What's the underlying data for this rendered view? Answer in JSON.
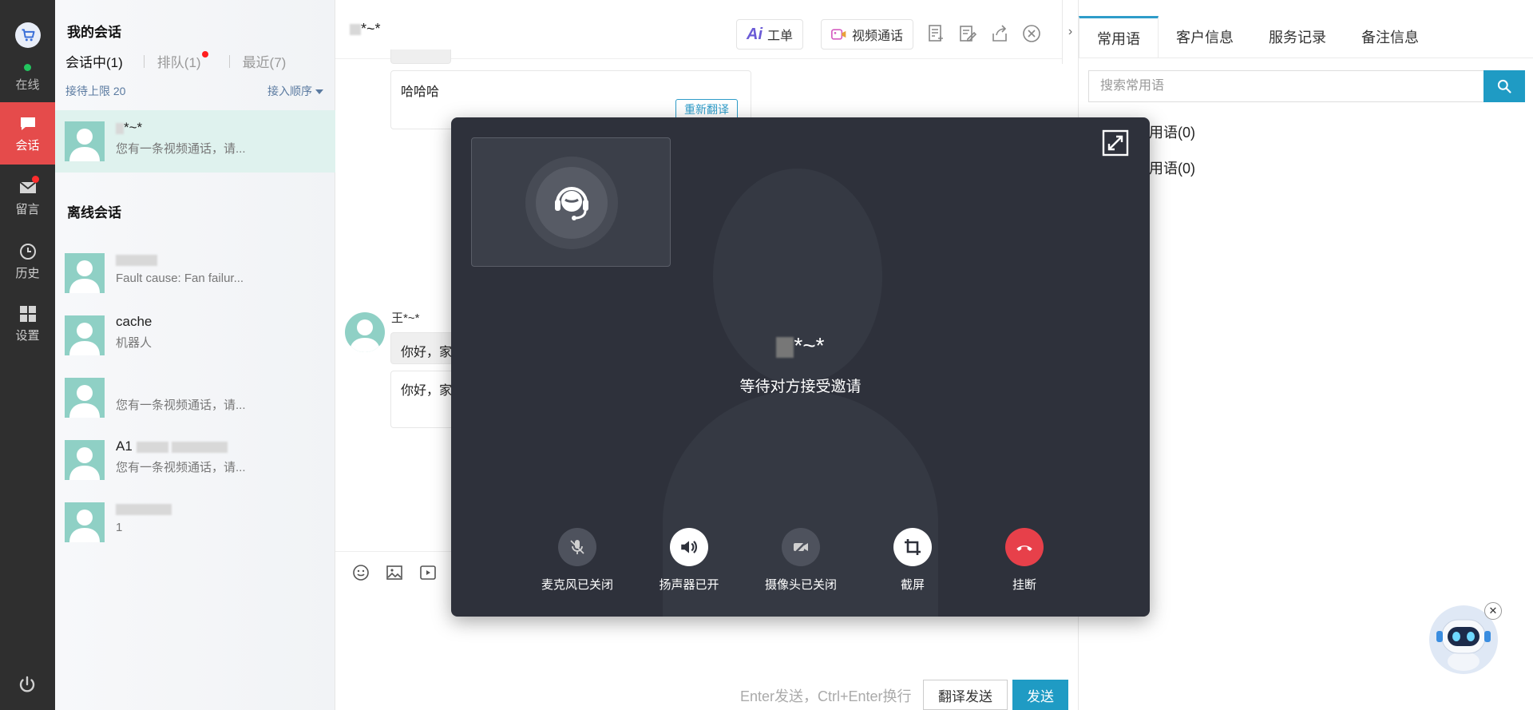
{
  "rail": {
    "status": "在线",
    "nav": [
      {
        "label": "会话",
        "icon": "chat-icon",
        "active": true
      },
      {
        "label": "留言",
        "icon": "mail-icon",
        "active": false,
        "badge": true
      },
      {
        "label": "历史",
        "icon": "clock-icon",
        "active": false
      },
      {
        "label": "设置",
        "icon": "grid-icon",
        "active": false
      }
    ]
  },
  "conversations": {
    "title": "我的会话",
    "tabs": [
      {
        "label": "会话中(1)",
        "active": true
      },
      {
        "label": "排队(1)",
        "dot": true
      },
      {
        "label": "最近(7)"
      }
    ],
    "limit": "接待上限 20",
    "order": "接入顺序",
    "active_item": {
      "name": "*~*",
      "snippet": "您有一条视频通话，请..."
    },
    "offline_title": "离线会话",
    "offline_items": [
      {
        "name": "",
        "snippet": "Fault cause: Fan failur..."
      },
      {
        "name": "cache",
        "snippet": "机器人"
      },
      {
        "name": "",
        "snippet": "您有一条视频通话，请..."
      },
      {
        "name": "A1",
        "snippet": "您有一条视频通话，请..."
      },
      {
        "name": "",
        "snippet": "1"
      }
    ]
  },
  "chat": {
    "title": "*~*",
    "ai_button": "工单",
    "video_button": "视频通话",
    "messages": {
      "m1": "哈哈哈",
      "retranslate": "重新翻译",
      "sender": "王*~*",
      "m2": "你好，家",
      "m3": "你好，家"
    },
    "hint": "Enter发送，Ctrl+Enter换行",
    "translate_send": "翻译发送",
    "send": "发送"
  },
  "right_panel": {
    "tabs": [
      "常用语",
      "客户信息",
      "服务记录",
      "备注信息"
    ],
    "search_placeholder": "搜索常用语",
    "groups": [
      "常用语(0)",
      "常用语(0)"
    ]
  },
  "video_call": {
    "callee": "*~*",
    "status": "等待对方接受邀请",
    "controls": [
      {
        "label": "麦克风已关闭",
        "icon": "mic-off-icon"
      },
      {
        "label": "扬声器已开",
        "icon": "speaker-icon"
      },
      {
        "label": "摄像头已关闭",
        "icon": "camera-off-icon"
      },
      {
        "label": "截屏",
        "icon": "crop-icon"
      },
      {
        "label": "挂断",
        "icon": "hangup-icon"
      }
    ]
  },
  "colors": {
    "accent": "#1f9bc4",
    "rail_active": "#e54b4b",
    "hangup": "#e7404a",
    "modal_bg": "#2e313b"
  }
}
